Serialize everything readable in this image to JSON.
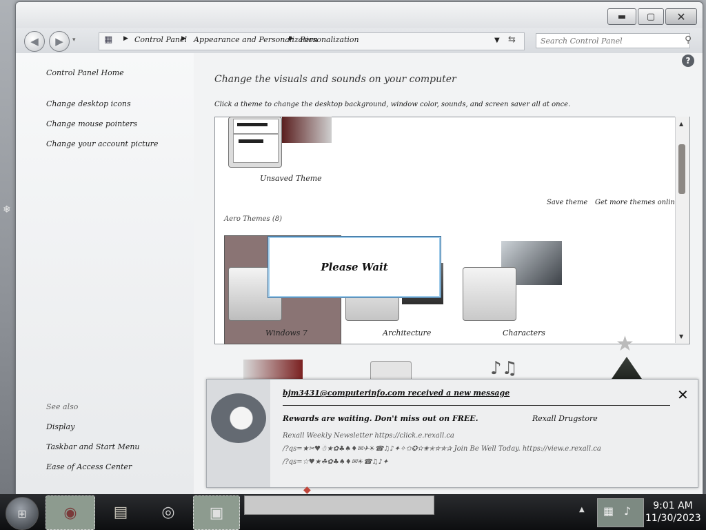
{
  "window": {
    "minimize_icon": "minimize-icon",
    "maximize_icon": "maximize-icon",
    "close_icon": "close-icon"
  },
  "navigation": {
    "breadcrumb": [
      "Control Panel",
      "Appearance and Personalization",
      "Personalization"
    ],
    "search_placeholder": "Search Control Panel"
  },
  "left_pane": {
    "home": "Control Panel Home",
    "links": [
      "Change desktop icons",
      "Change mouse pointers",
      "Change your account picture"
    ],
    "see_also_title": "See also",
    "see_also": [
      "Display",
      "Taskbar and Start Menu",
      "Ease of Access Center"
    ]
  },
  "main": {
    "heading": "Change the visuals and sounds on your computer",
    "subheading": "Click a theme to change the desktop background, window color, sounds, and screen saver all at once.",
    "unsaved_theme": "Unsaved Theme",
    "save_theme": "Save theme",
    "get_more": "Get more themes online",
    "aero_section": "Aero Themes (8)",
    "themes": [
      "Windows 7",
      "Architecture",
      "Characters"
    ]
  },
  "dialog": {
    "message": "Please Wait"
  },
  "notification": {
    "title": "bjm3431@computerinfo.com received a new message",
    "subject": "Rewards are waiting. Don't miss out on FREE.",
    "sender": "Rexall Drugstore",
    "body_line1": "Rexall Weekly Newsletter https://click.e.rexall.ca",
    "body_line2": "/?qs=★✂♥☃★✿♣♠♦✉✈☀☎♫♪✦✧✩✪✫✬✭✮✯✰ Join Be Well Today. https://view.e.rexall.ca",
    "body_line3": "/?qs=☆♥★☘✿♣♠♦✉☀☎♫♪✦"
  },
  "taskbar": {
    "time": "9:01 AM",
    "date": "11/30/2023"
  }
}
